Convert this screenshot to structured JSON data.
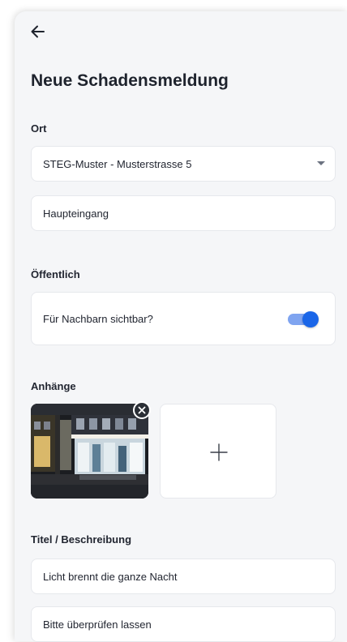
{
  "header": {
    "back_icon": "arrow-left-icon",
    "title": "Neue Schadensmeldung"
  },
  "location": {
    "label": "Ort",
    "property_select": "STEG-Muster - Musterstrasse 5",
    "entrance_field": "Haupteingang"
  },
  "public": {
    "label": "Öffentlich",
    "toggle_label": "Für Nachbarn sichtbar?",
    "toggle_on": true,
    "accent_color": "#1a66e8"
  },
  "attachments": {
    "label": "Anhänge",
    "remove_icon": "close-icon",
    "add_icon": "plus-icon"
  },
  "details": {
    "label": "Titel / Beschreibung",
    "title_field": "Licht brennt die ganze Nacht",
    "description_field": "Bitte überprüfen lassen"
  }
}
